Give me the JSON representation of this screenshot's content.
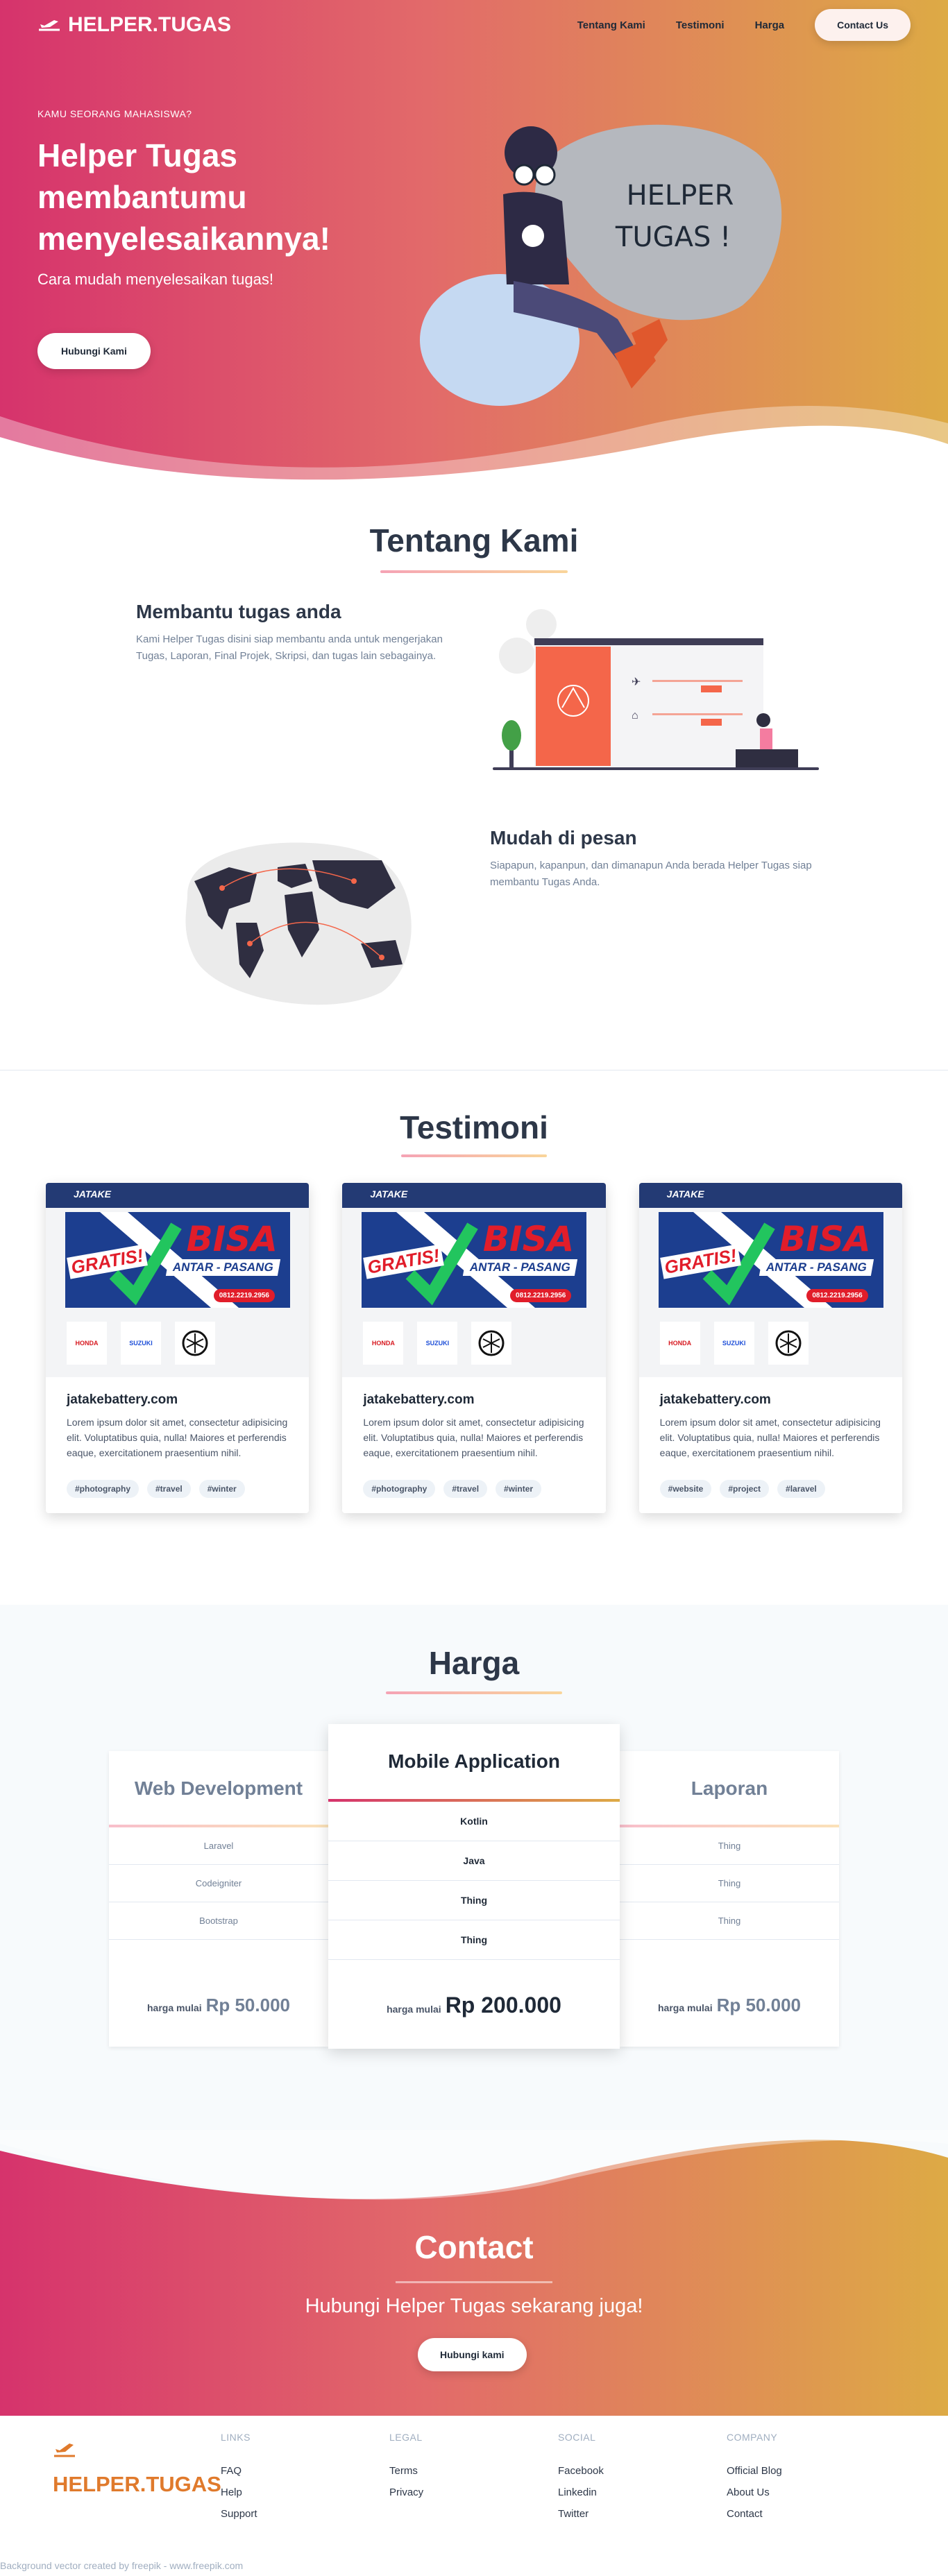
{
  "nav": {
    "brand": "HELPER.TUGAS",
    "links": [
      "Tentang Kami",
      "Testimoni",
      "Harga"
    ],
    "cta": "Contact Us"
  },
  "hero": {
    "eyebrow": "KAMU SEORANG MAHASISWA?",
    "title": "Helper Tugas membantumu menyelesaikannya!",
    "subtitle": "Cara mudah menyelesaikan tugas!",
    "button": "Hubungi Kami",
    "bubble_line1": "HELPER",
    "bubble_line2": "TUGAS !"
  },
  "about": {
    "title": "Tentang Kami",
    "features": [
      {
        "title": "Membantu tugas anda",
        "text": "Kami Helper Tugas disini siap membantu anda untuk mengerjakan Tugas, Laporan, Final Projek, Skripsi, dan tugas lain sebagainya."
      },
      {
        "title": "Mudah di pesan",
        "text": "Siapapun, kapanpun, dan dimanapun Anda berada Helper Tugas siap membantu Tugas Anda."
      }
    ]
  },
  "testimoni": {
    "title": "Testimoni",
    "shot": {
      "logo": "JATAKE",
      "bisa": "BISA",
      "antar": "ANTAR - PASANG",
      "gratis": "GRATIS!",
      "phone": "0812.2219.2956",
      "brands": [
        "HONDA",
        "SUZUKI",
        ""
      ]
    },
    "cards": [
      {
        "title": "jatakebattery.com",
        "text": "Lorem ipsum dolor sit amet, consectetur adipisicing elit. Voluptatibus quia, nulla! Maiores et perferendis eaque, exercitationem praesentium nihil.",
        "tags": [
          "#photography",
          "#travel",
          "#winter"
        ]
      },
      {
        "title": "jatakebattery.com",
        "text": "Lorem ipsum dolor sit amet, consectetur adipisicing elit. Voluptatibus quia, nulla! Maiores et perferendis eaque, exercitationem praesentium nihil.",
        "tags": [
          "#photography",
          "#travel",
          "#winter"
        ]
      },
      {
        "title": "jatakebattery.com",
        "text": "Lorem ipsum dolor sit amet, consectetur adipisicing elit. Voluptatibus quia, nulla! Maiores et perferendis eaque, exercitationem praesentium nihil.",
        "tags": [
          "#website",
          "#project",
          "#laravel"
        ]
      }
    ]
  },
  "harga": {
    "title": "Harga",
    "plans": [
      {
        "name": "Web Development",
        "items": [
          "Laravel",
          "Codeigniter",
          "Bootstrap"
        ],
        "prefix": "harga mulai",
        "price": "Rp 50.000"
      },
      {
        "name": "Mobile Application",
        "items": [
          "Kotlin",
          "Java",
          "Thing",
          "Thing"
        ],
        "prefix": "harga mulai",
        "price": "Rp 200.000"
      },
      {
        "name": "Laporan",
        "items": [
          "Thing",
          "Thing",
          "Thing"
        ],
        "prefix": "harga mulai",
        "price": "Rp 50.000"
      }
    ]
  },
  "contact": {
    "title": "Contact",
    "subtitle": "Hubungi Helper Tugas sekarang juga!",
    "button": "Hubungi kami"
  },
  "footer": {
    "brand": "HELPER.TUGAS",
    "columns": [
      {
        "heading": "LINKS",
        "items": [
          "FAQ",
          "Help",
          "Support"
        ]
      },
      {
        "heading": "LEGAL",
        "items": [
          "Terms",
          "Privacy"
        ]
      },
      {
        "heading": "SOCIAL",
        "items": [
          "Facebook",
          "Linkedin",
          "Twitter"
        ]
      },
      {
        "heading": "COMPANY",
        "items": [
          "Official Blog",
          "About Us",
          "Contact"
        ]
      }
    ],
    "credit": "Background vector created by freepik - www.freepik.com"
  },
  "colors": {
    "accent_start": "#d6336c",
    "accent_end": "#ddaa45",
    "brand_orange": "#e07a2c"
  }
}
